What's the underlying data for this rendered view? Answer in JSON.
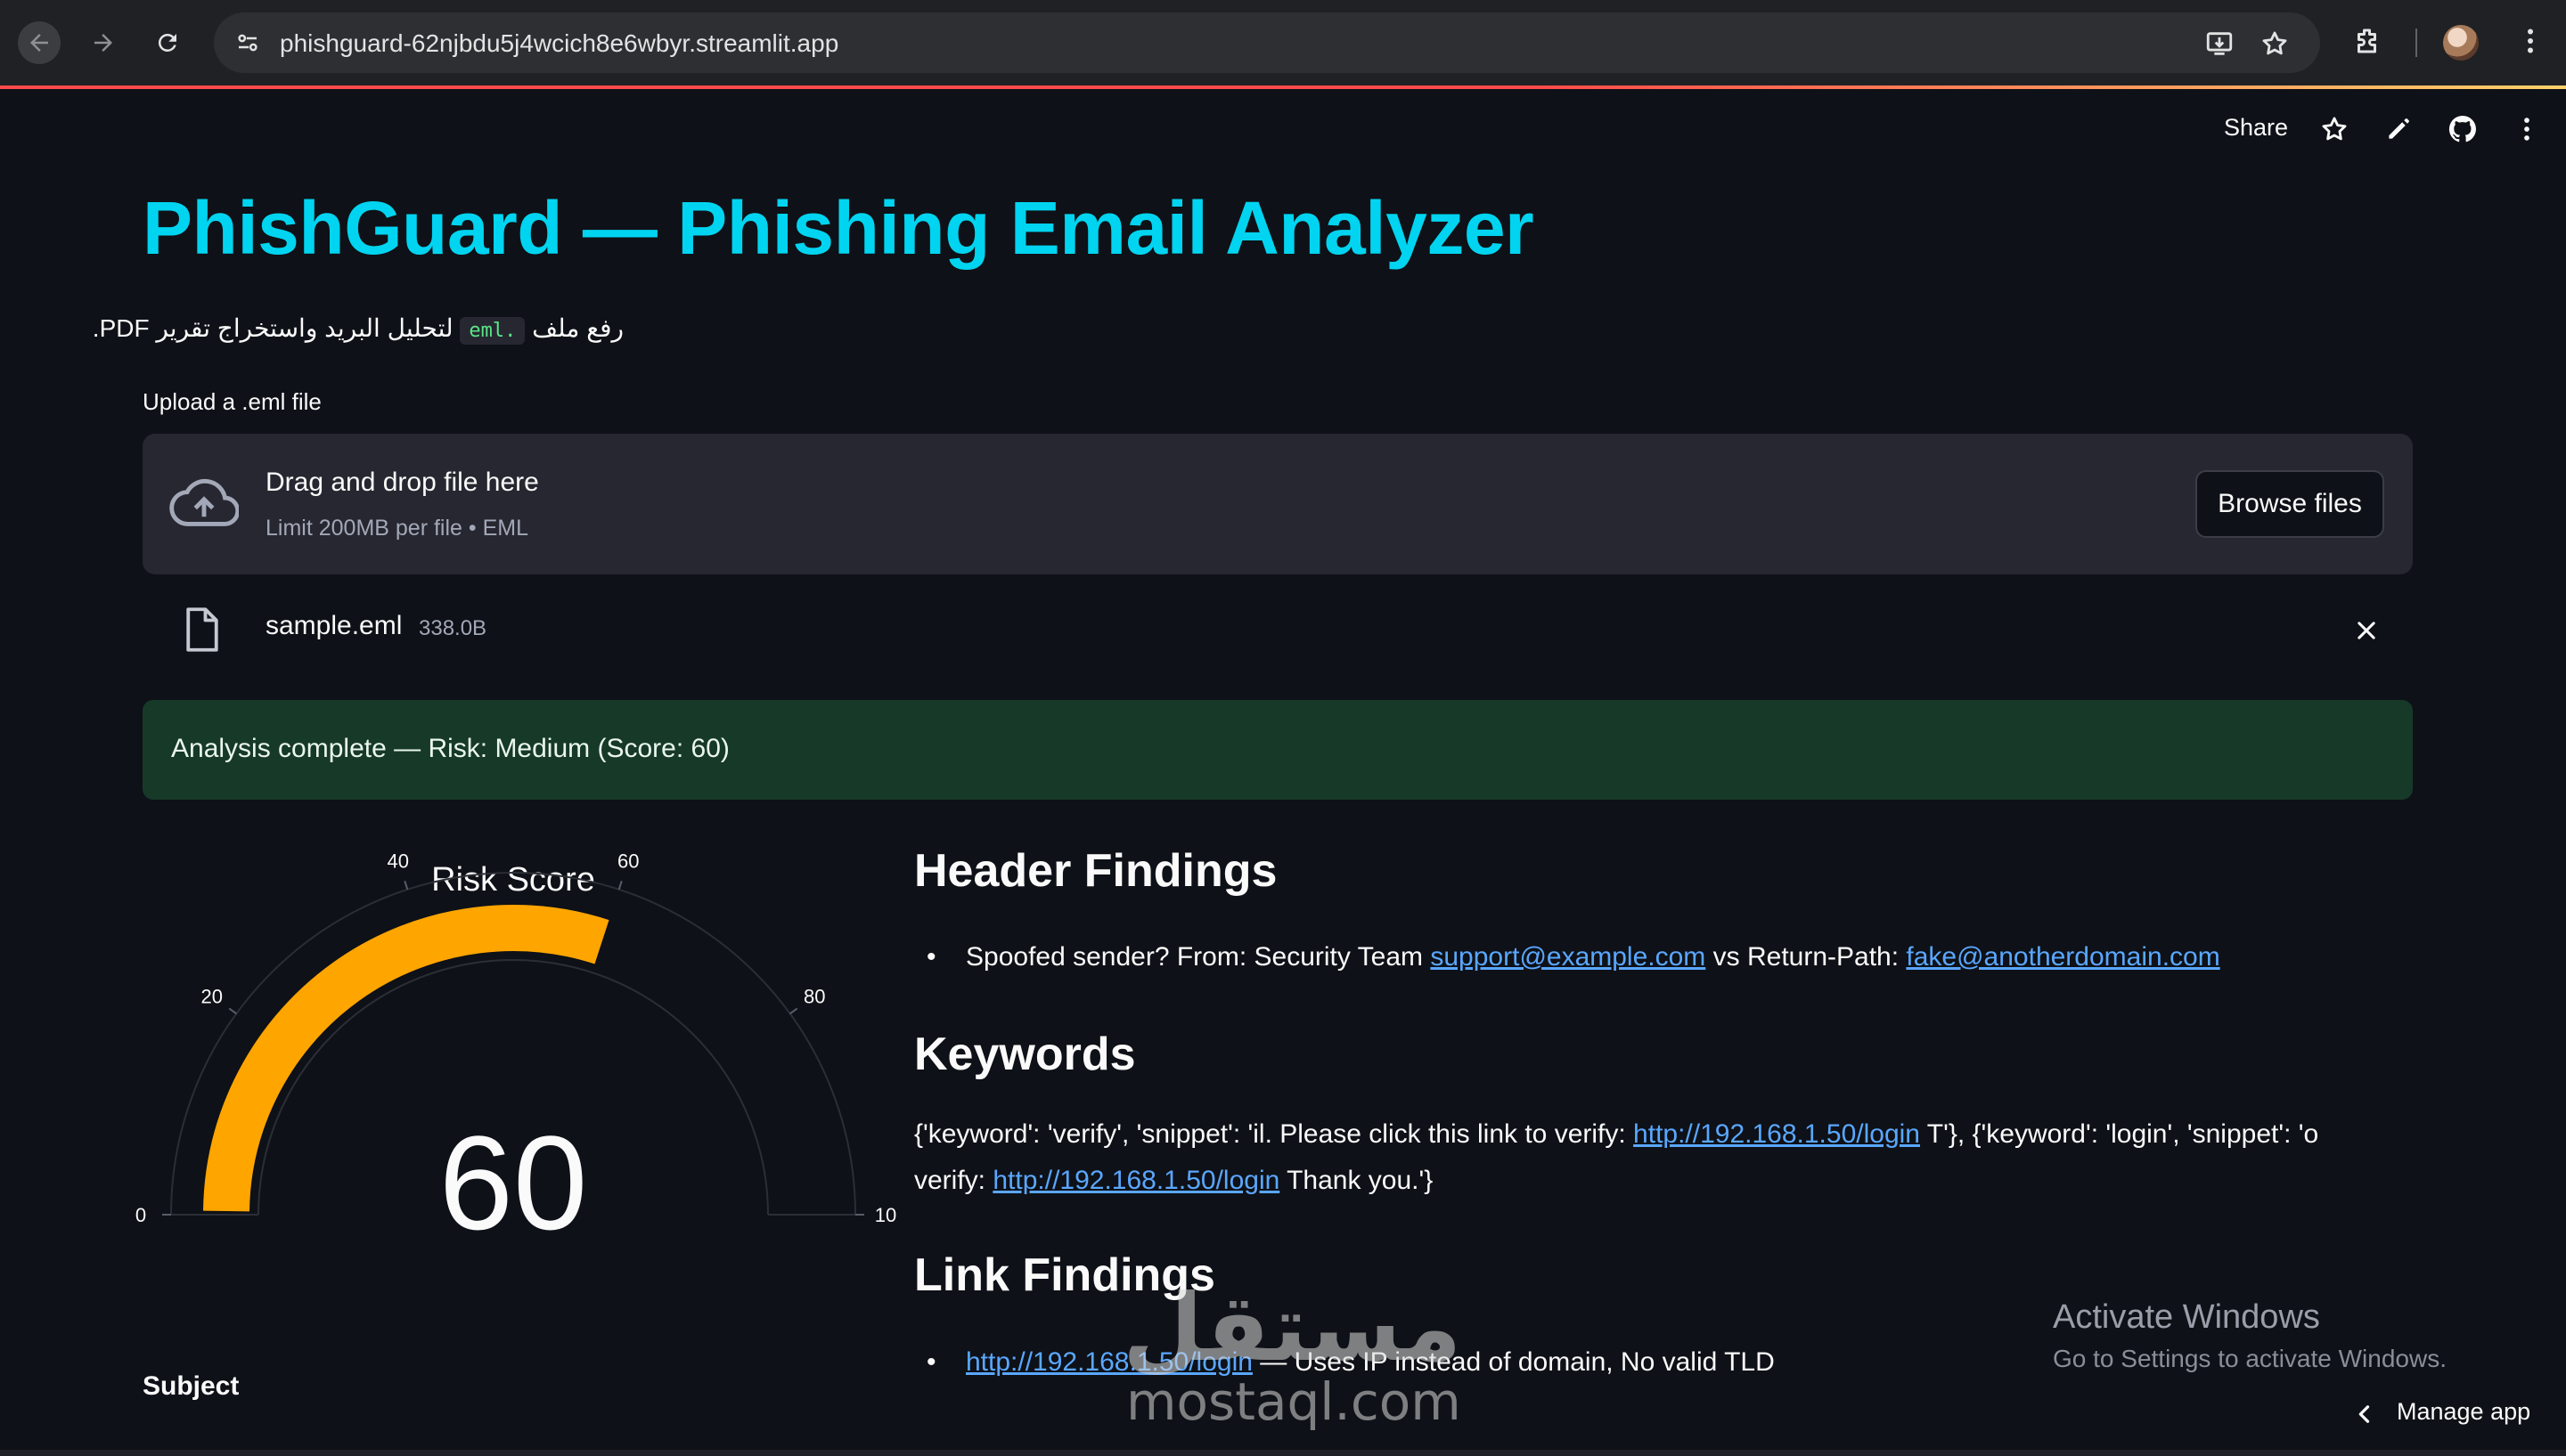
{
  "browser": {
    "url": "phishguard-62njbdu5j4wcich8e6wbyr.streamlit.app"
  },
  "toolbar": {
    "share_label": "Share"
  },
  "page": {
    "title": "PhishGuard — Phishing Email Analyzer",
    "subtitle_before": "رفع ملف",
    "subtitle_code": ".eml",
    "subtitle_after": "لتحليل البريد واستخراج تقرير PDF.",
    "upload_label": "Upload a .eml file"
  },
  "uploader": {
    "drop_text": "Drag and drop file here",
    "limit_text": "Limit 200MB per file • EML",
    "browse_label": "Browse files",
    "file_name": "sample.eml",
    "file_size": "338.0B"
  },
  "status": {
    "message": "Analysis complete — Risk: Medium (Score: 60)"
  },
  "gauge": {
    "title": "Risk Score",
    "value": 60,
    "value_label": "60",
    "min": 0,
    "max": 100,
    "ticks": [
      "0",
      "20",
      "40",
      "60",
      "80",
      "10"
    ],
    "bar_color": "#ffa500"
  },
  "header_findings": {
    "heading": "Header Findings",
    "items": [
      {
        "prefix": "Spoofed sender? From: Security Team ",
        "link1": "support@example.com",
        "middle": " vs Return-Path: ",
        "link2": "fake@anotherdomain.com"
      }
    ]
  },
  "keywords": {
    "heading": "Keywords",
    "line1_prefix": "{'keyword': 'verify', 'snippet': 'il. Please click this link to verify: ",
    "line1_link": "http://192.168.1.50/login",
    "line1_suffix": " T'}, {'keyword': 'login', 'snippet': 'o",
    "line2_prefix": "verify: ",
    "line2_link": "http://192.168.1.50/login",
    "line2_suffix": " Thank you.'}"
  },
  "link_findings": {
    "heading": "Link Findings",
    "items": [
      {
        "link": "http://192.168.1.50/login",
        "text": " — Uses IP instead of domain, No valid TLD"
      }
    ]
  },
  "subject_label": "Subject",
  "windows": {
    "title": "Activate Windows",
    "subtitle": "Go to Settings to activate Windows."
  },
  "manage_app_label": "Manage app",
  "watermark": {
    "arabic": "مستقل",
    "latin": "mostaql.com"
  }
}
